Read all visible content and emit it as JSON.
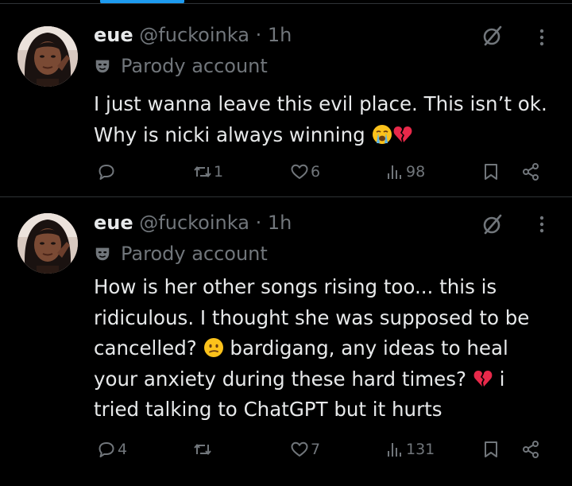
{
  "colors": {
    "background": "#000000",
    "text": "#e7e9ea",
    "secondary": "#71767b",
    "divider": "#2f3336",
    "accent": "#1d9bf0"
  },
  "tweets": [
    {
      "display_name": "eue",
      "handle": "@fuckoinka",
      "separator": "·",
      "time": "1h",
      "badge": "Parody account",
      "text_lines": [
        "I just wanna leave this evil place. This isn’t ok.",
        "Why is nicki always winning"
      ],
      "emojis": [
        "loudly-crying-face-emoji",
        "broken-heart-emoji"
      ],
      "replies": "",
      "reposts": "1",
      "likes": "6",
      "views": "98"
    },
    {
      "display_name": "eue",
      "handle": "@fuckoinka",
      "separator": "·",
      "time": "1h",
      "badge": "Parody account",
      "text_lines": [
        "How is her other songs rising too... this is",
        "ridiculous. I thought she was supposed to be",
        "cancelled?",
        "bardigang, any ideas to heal",
        "your anxiety during these hard times?",
        "i",
        "tried talking to ChatGPT but it hurts"
      ],
      "emojis": [
        "confused-face-emoji",
        "broken-heart-emoji"
      ],
      "replies": "4",
      "reposts": "",
      "likes": "7",
      "views": "131"
    }
  ],
  "icons": {
    "reply": "reply-bubble-icon",
    "repost": "repost-icon",
    "like": "heart-icon",
    "views": "views-chart-icon",
    "bookmark": "bookmark-icon",
    "share": "share-icon",
    "grok": "grok-icon",
    "more": "more-dots-icon",
    "parody": "parody-mask-icon"
  }
}
